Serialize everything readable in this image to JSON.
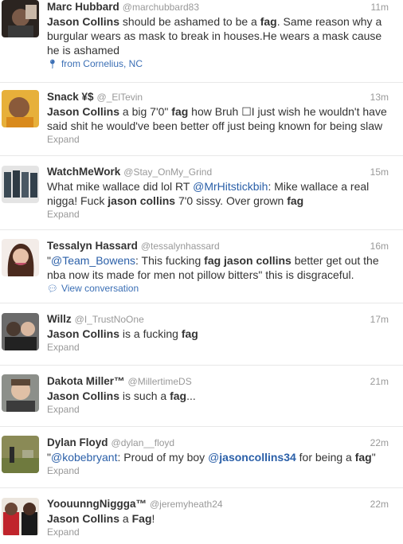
{
  "tweets": [
    {
      "fullname": "Marc Hubbard",
      "handle": "@marchubbard83",
      "time": "11m",
      "text_parts": [
        {
          "t": "Jason Collins",
          "b": true
        },
        {
          "t": " should be ashamed to be a "
        },
        {
          "t": "fag",
          "b": true
        },
        {
          "t": ". Same reason why a burgular wears as mask to break in houses.He wears a mask cause he is ashamed"
        }
      ],
      "meta": {
        "label": "from Cornelius, NC",
        "icon": "map-pin-icon",
        "style": "blue"
      }
    },
    {
      "fullname": "Snack ¥$",
      "handle": "@_ElTevin",
      "time": "13m",
      "text_parts": [
        {
          "t": "Jason Collins",
          "b": true
        },
        {
          "t": " a big 7'0\" "
        },
        {
          "t": "fag",
          "b": true
        },
        {
          "t": " how Bruh ☐I just wish he wouldn't have said shit he would've been better off just being known for being slaw"
        }
      ],
      "meta": {
        "label": "Expand",
        "style": "gray"
      }
    },
    {
      "fullname": "WatchMeWork",
      "handle": "@Stay_OnMy_Grind",
      "time": "15m",
      "text_parts": [
        {
          "t": "What mike wallace did lol RT "
        },
        {
          "t": "@MrHitstickbih",
          "m": true
        },
        {
          "t": ": Mike wallace a real nigga! Fuck "
        },
        {
          "t": "jason collins",
          "b": true
        },
        {
          "t": " 7'0 sissy. Over grown "
        },
        {
          "t": "fag",
          "b": true
        }
      ],
      "meta": {
        "label": "Expand",
        "style": "gray"
      }
    },
    {
      "fullname": "Tessalyn Hassard",
      "handle": "@tessalynhassard",
      "time": "16m",
      "text_parts": [
        {
          "t": "\""
        },
        {
          "t": "@Team_Bowens",
          "m": true
        },
        {
          "t": ": This fucking "
        },
        {
          "t": "fag jason collins",
          "b": true
        },
        {
          "t": " better get out the nba now its made for men not pillow bitters\" this is disgraceful."
        }
      ],
      "meta": {
        "label": "View conversation",
        "icon": "speech-bubble-icon",
        "style": "blue"
      }
    },
    {
      "fullname": "Willz",
      "handle": "@I_TrustNoOne",
      "time": "17m",
      "text_parts": [
        {
          "t": "Jason Collins",
          "b": true
        },
        {
          "t": " is a fucking "
        },
        {
          "t": "fag",
          "b": true
        }
      ],
      "meta": {
        "label": "Expand",
        "style": "gray"
      }
    },
    {
      "fullname": "Dakota Miller™",
      "handle": "@MillertimeDS",
      "time": "21m",
      "text_parts": [
        {
          "t": "Jason Collins",
          "b": true
        },
        {
          "t": " is such a "
        },
        {
          "t": "fag",
          "b": true
        },
        {
          "t": "..."
        }
      ],
      "meta": {
        "label": "Expand",
        "style": "gray"
      }
    },
    {
      "fullname": "Dylan Floyd",
      "handle": "@dylan__floyd",
      "time": "22m",
      "text_parts": [
        {
          "t": "\""
        },
        {
          "t": "@kobebryant",
          "m": true
        },
        {
          "t": ": Proud of my boy "
        },
        {
          "t": "@",
          "m": true
        },
        {
          "t": "jasoncollins34",
          "m": true,
          "b": true
        },
        {
          "t": " for being a "
        },
        {
          "t": "fag",
          "b": true
        },
        {
          "t": "\""
        }
      ],
      "meta": {
        "label": "Expand",
        "style": "gray"
      }
    },
    {
      "fullname": "YoouunngNiggga™",
      "handle": "@jeremyheath24",
      "time": "22m",
      "text_parts": [
        {
          "t": "Jason Collins",
          "b": true
        },
        {
          "t": " a "
        },
        {
          "t": "Fag",
          "b": true
        },
        {
          "t": "!"
        }
      ],
      "meta": {
        "label": "Expand",
        "style": "gray"
      }
    }
  ]
}
